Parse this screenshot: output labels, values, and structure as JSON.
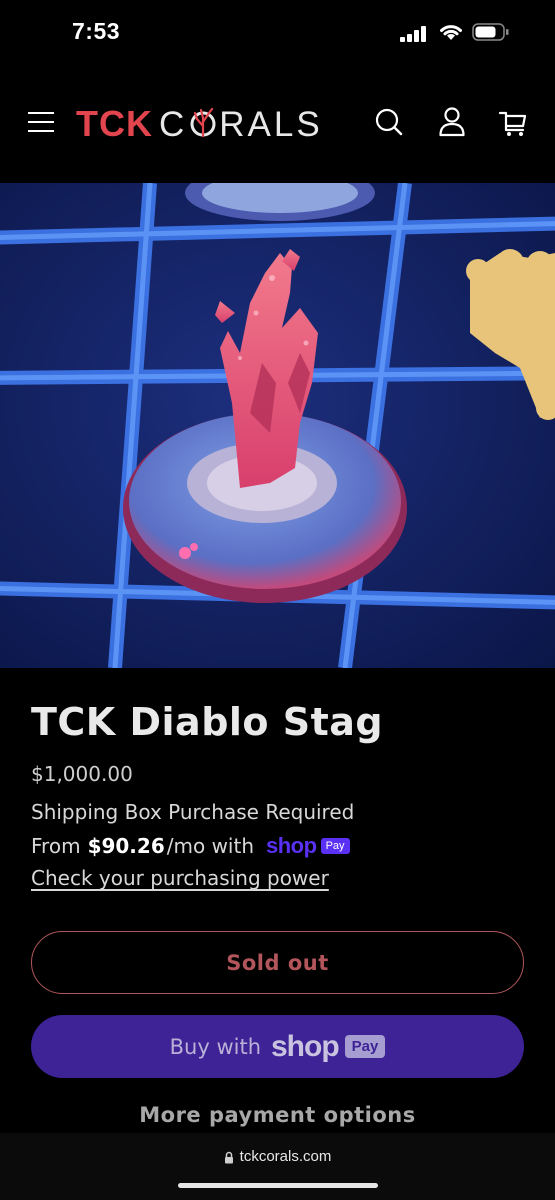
{
  "status_bar": {
    "time": "7:53"
  },
  "header": {
    "logo_part1": "TCK",
    "logo_part2": "C",
    "logo_part3": "RALS"
  },
  "product": {
    "title": "TCK Diablo Stag",
    "price": "$1,000.00",
    "shipping_note": "Shipping Box Purchase Required",
    "installment_prefix": "From",
    "installment_amount": "$90.26",
    "installment_suffix": "/mo with",
    "shop_wordmark": "shop",
    "pay_badge": "Pay",
    "check_link": "Check your purchasing power"
  },
  "buttons": {
    "sold_out": "Sold out",
    "buy_with": "Buy with",
    "shop": "shop",
    "pay": "Pay",
    "more_options": "More payment options"
  },
  "browser": {
    "url": "tckcorals.com"
  },
  "colors": {
    "brand_red": "#e2454e",
    "shop_purple": "#5a31f4",
    "shop_button_bg": "#3e2397"
  }
}
